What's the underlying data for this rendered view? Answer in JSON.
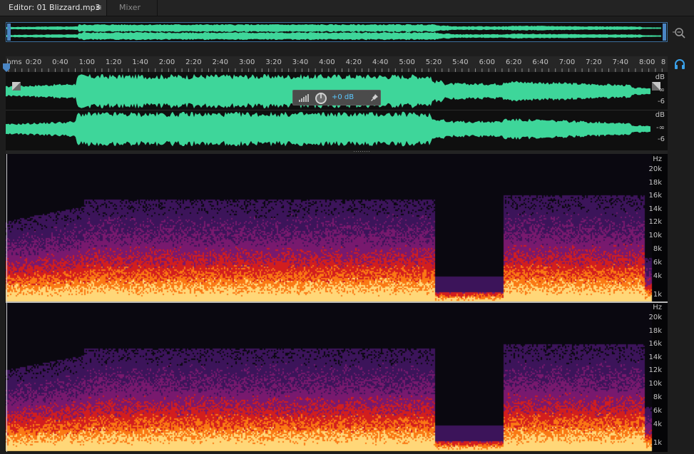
{
  "tabs": {
    "editor_label": "Editor: 01 Blizzard.mp3",
    "editor_menu": "≡",
    "mixer_label": "Mixer"
  },
  "ruler": {
    "labels": [
      "hms",
      "0:20",
      "0:40",
      "1:00",
      "1:20",
      "1:40",
      "2:00",
      "2:20",
      "2:40",
      "3:00",
      "3:20",
      "3:40",
      "4:00",
      "4:20",
      "4:40",
      "5:00",
      "5:20",
      "5:40",
      "6:00",
      "6:20",
      "6:40",
      "7:00",
      "7:20",
      "7:40",
      "8:00",
      "8"
    ]
  },
  "waveform": {
    "db_labels": [
      "dB",
      "-∞",
      "-6",
      "dB",
      "-∞",
      "-6"
    ],
    "color": "#3ed69a"
  },
  "hud": {
    "value": "+0 dB"
  },
  "spectrogram": {
    "hz_labels": [
      "Hz",
      "20k",
      "18k",
      "16k",
      "14k",
      "12k",
      "10k",
      "8k",
      "6k",
      "4k",
      "1k",
      "Hz",
      "20k",
      "18k",
      "16k",
      "14k",
      "12k",
      "10k",
      "8k",
      "6k",
      "4k",
      "1k"
    ]
  }
}
